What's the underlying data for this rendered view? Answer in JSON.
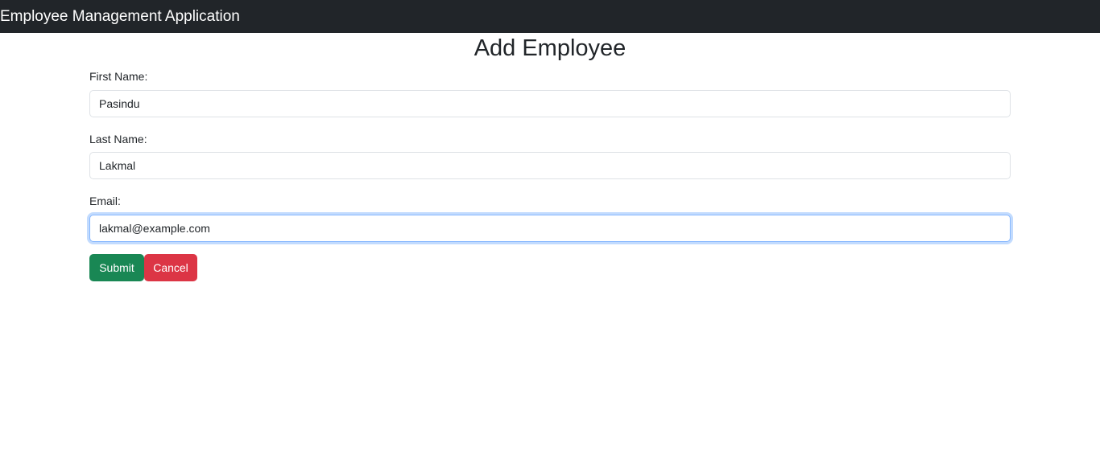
{
  "navbar": {
    "brand": "Employee Management Application"
  },
  "page": {
    "title": "Add Employee"
  },
  "form": {
    "first_name": {
      "label": "First Name:",
      "value": "Pasindu"
    },
    "last_name": {
      "label": "Last Name:",
      "value": "Lakmal"
    },
    "email": {
      "label": "Email:",
      "value": "lakmal@example.com"
    },
    "submit_label": "Submit",
    "cancel_label": "Cancel"
  },
  "colors": {
    "navbar_bg": "#212529",
    "submit_bg": "#198754",
    "cancel_bg": "#dc3545",
    "focus_ring": "#86b7fe"
  }
}
